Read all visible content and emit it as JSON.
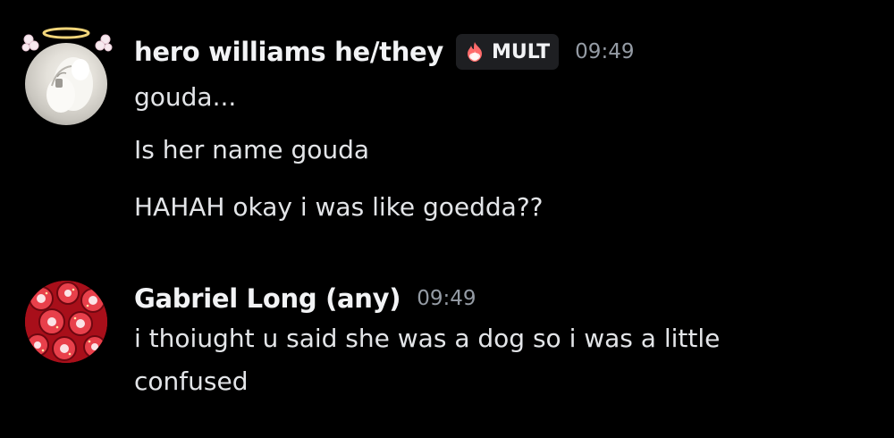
{
  "colors": {
    "background": "#000000",
    "username": "#f2f3f5",
    "message_text": "#e3e5e8",
    "timestamp": "#949ba4",
    "tag_background": "#1e1f22",
    "tag_flame": "#ff6b6b"
  },
  "messages": [
    {
      "author": "hero williams he/they",
      "tag": {
        "icon": "flame-icon",
        "label": "MULT"
      },
      "timestamp": "09:49",
      "avatar_decoration": "angel-halo-wings",
      "lines": [
        "gouda...",
        "Is her name gouda",
        "HAHAH okay i was like goedda??"
      ]
    },
    {
      "author": "Gabriel Long (any)",
      "timestamp": "09:49",
      "lines": [
        "i thoiught u said she was a dog so i was a little",
        "confused"
      ]
    }
  ]
}
